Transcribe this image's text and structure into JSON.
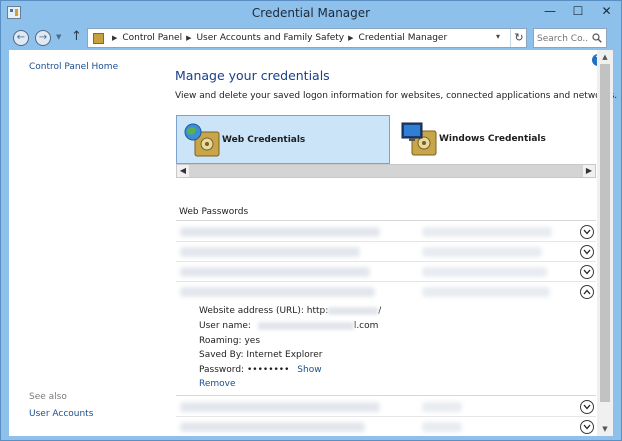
{
  "window": {
    "title": "Credential Manager",
    "minimize": "—",
    "maximize": "☐",
    "close": "✕"
  },
  "address": {
    "crumbs": [
      "Control Panel",
      "User Accounts and Family Safety",
      "Credential Manager"
    ],
    "search_placeholder": "Search Co..."
  },
  "sidebar": {
    "home_link": "Control Panel Home",
    "see_also": "See also",
    "user_accounts": "User Accounts"
  },
  "main": {
    "title": "Manage your credentials",
    "description": "View and delete your saved logon information for websites, connected applications and networks.",
    "tabs": [
      {
        "label": "Web Credentials",
        "selected": true
      },
      {
        "label": "Windows Credentials",
        "selected": false
      }
    ],
    "section_label": "Web Passwords",
    "detail": {
      "url_label": "Website address (URL):",
      "url_prefix": "http:",
      "url_suffix": "/",
      "username_label": "User name:",
      "username_suffix": "l.com",
      "roaming_label": "Roaming:",
      "roaming_value": "yes",
      "saved_by_label": "Saved By:",
      "saved_by_value": "Internet Explorer",
      "password_label": "Password:",
      "password_mask": "••••••••",
      "show_label": "Show",
      "remove_label": "Remove"
    }
  },
  "colors": {
    "title_blue": "#1a3f88",
    "link_blue": "#1a4f8f",
    "tab_selected_bg": "#cce4f7",
    "chrome": "#8ec0ec"
  }
}
